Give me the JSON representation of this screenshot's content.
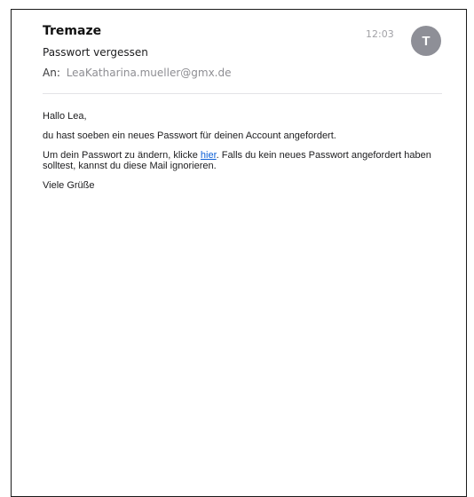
{
  "email": {
    "sender": "Tremaze",
    "subject": "Passwort vergessen",
    "recipient_label": "An:",
    "recipient": "LeaKatharina.mueller@gmx.de",
    "time": "12:03",
    "avatar_letter": "T",
    "accent_color": "#0b5fd6",
    "avatar_color": "#8e8f97"
  },
  "body": {
    "greeting": "Hallo Lea,",
    "line1": "du hast soeben ein neues Passwort für deinen Account angefordert.",
    "line2_before": "Um dein Passwort zu ändern, klicke ",
    "link_text": "hier",
    "line2_after": ". Falls du kein neues Passwort angefordert haben solltest, kannst du diese Mail ignorieren.",
    "closing": "Viele Grüße"
  }
}
